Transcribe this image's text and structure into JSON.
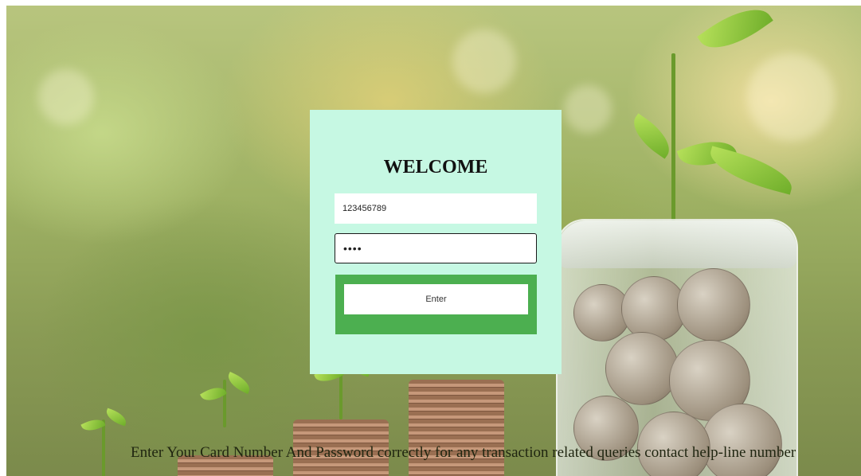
{
  "login": {
    "title": "WELCOME",
    "card_number_value": "123456789",
    "password_value": "••••",
    "enter_label": "Enter"
  },
  "footer": {
    "note": "Enter Your Card Number And Password correctly for any transaction related queries contact help-line number"
  },
  "colors": {
    "card_background": "#c6f8e3",
    "button_frame": "#4caf50"
  }
}
